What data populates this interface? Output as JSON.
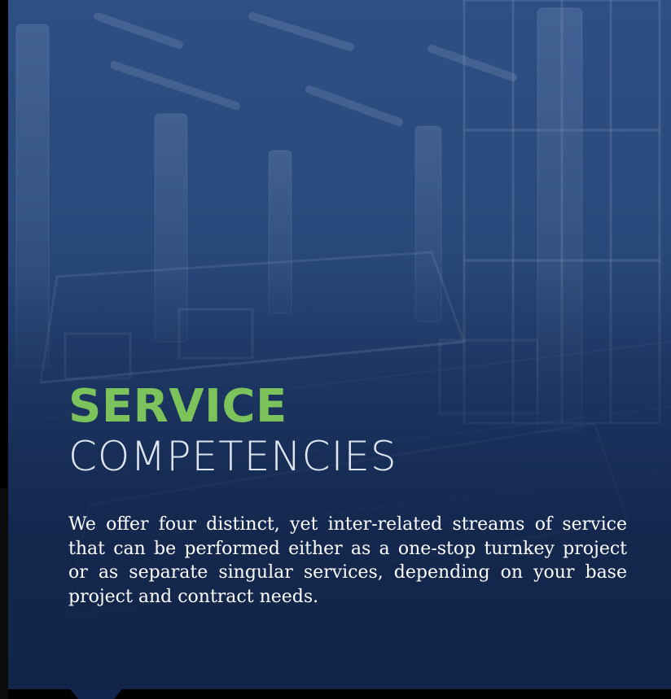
{
  "hero": {
    "title_line_1": "SERVICE",
    "title_line_2": "COMPETENCIES",
    "description": "We offer four distinct, yet inter-related streams of service that can be performed either as a one-stop turnkey project or as separate singular services, depending on your base project and contract needs."
  },
  "colors": {
    "accent_green": "#7cc35b",
    "hero_blue": "#2a4a7d",
    "text_white": "#ffffff"
  }
}
